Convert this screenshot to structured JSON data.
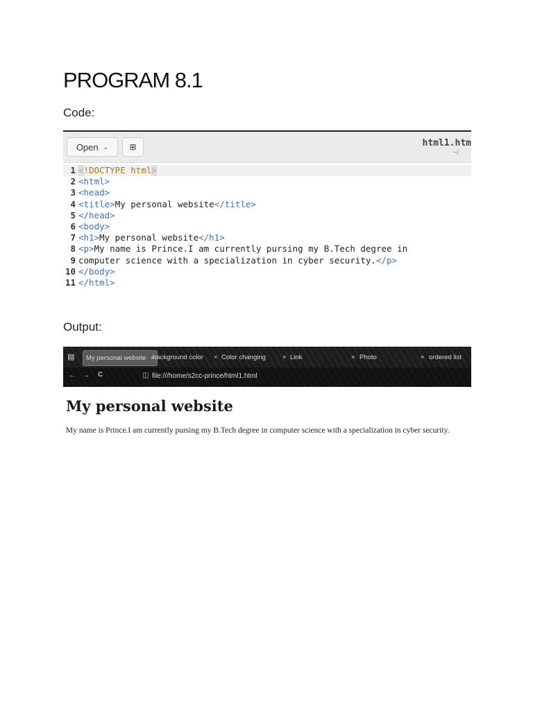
{
  "heading": "PROGRAM 8.1",
  "code_label": "Code:",
  "output_label": "Output:",
  "editor": {
    "open_label": "Open",
    "new_tab_icon": "new-document-icon",
    "filename": "html1.htm",
    "path": "~/",
    "lines": [
      {
        "n": "1",
        "segs": [
          {
            "c": "br",
            "t": "<"
          },
          {
            "c": "doc",
            "t": "!DOCTYPE html"
          },
          {
            "c": "br",
            "t": ">"
          }
        ]
      },
      {
        "n": "2",
        "segs": [
          {
            "c": "tag",
            "t": "<html>"
          }
        ]
      },
      {
        "n": "3",
        "segs": [
          {
            "c": "tag",
            "t": "<head>"
          }
        ]
      },
      {
        "n": "4",
        "segs": [
          {
            "c": "tag",
            "t": "<title>"
          },
          {
            "c": "txt",
            "t": "My personal website"
          },
          {
            "c": "tag",
            "t": "</title>"
          }
        ]
      },
      {
        "n": "5",
        "segs": [
          {
            "c": "tag",
            "t": "</head>"
          }
        ]
      },
      {
        "n": "6",
        "segs": [
          {
            "c": "tag",
            "t": "<body>"
          }
        ]
      },
      {
        "n": "7",
        "segs": [
          {
            "c": "tag",
            "t": "<h1>"
          },
          {
            "c": "txt",
            "t": "My personal website"
          },
          {
            "c": "tag",
            "t": "</h1>"
          }
        ]
      },
      {
        "n": "8",
        "segs": [
          {
            "c": "tag",
            "t": "<p>"
          },
          {
            "c": "txt",
            "t": "My name is Prince.I am currently pursing my B.Tech degree in"
          }
        ]
      },
      {
        "n": "9",
        "segs": [
          {
            "c": "txt",
            "t": "computer science with a specialization in cyber security."
          },
          {
            "c": "tag",
            "t": "</p>"
          }
        ]
      },
      {
        "n": "10",
        "segs": [
          {
            "c": "tag",
            "t": "</body>"
          }
        ]
      },
      {
        "n": "11",
        "segs": [
          {
            "c": "tag",
            "t": "</html>"
          }
        ]
      }
    ]
  },
  "browser": {
    "tabs": [
      {
        "label": "My personal website",
        "active": true
      },
      {
        "label": "background color"
      },
      {
        "label": "Color changing"
      },
      {
        "label": "Link"
      },
      {
        "label": "Photo"
      },
      {
        "label": "ordered list"
      }
    ],
    "close_glyph": "×",
    "url": "file:///home/s2cc-prince/html1.html",
    "page_h1": "My personal website",
    "page_p": "My name is Prince.I am currently pursing my B.Tech degree in computer science with a specialization in cyber security."
  }
}
